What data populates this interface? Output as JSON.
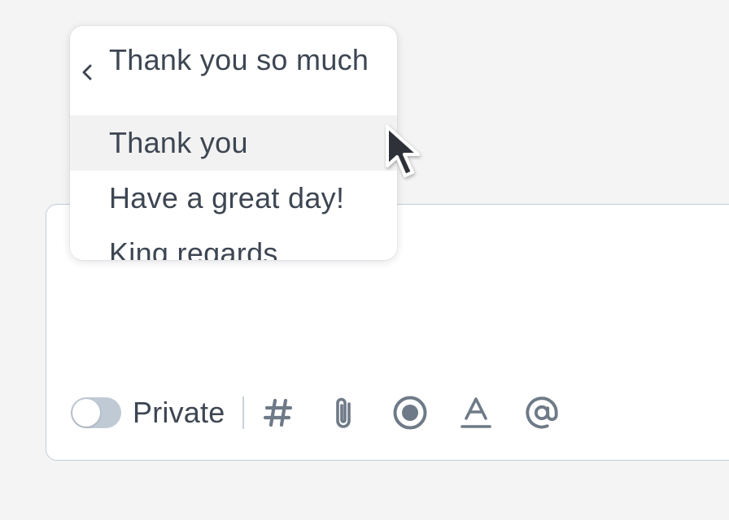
{
  "menu": {
    "header_label": "Thank you so much",
    "items": [
      {
        "label": "Thank you",
        "hovered": true
      },
      {
        "label": "Have a great day!",
        "hovered": false
      },
      {
        "label": "King regards",
        "hovered": false
      }
    ]
  },
  "composer": {
    "private_toggle": {
      "label": "Private",
      "on": false
    },
    "tools": [
      {
        "icon": "hashtag-icon"
      },
      {
        "icon": "paperclip-icon"
      },
      {
        "icon": "record-icon"
      },
      {
        "icon": "text-format-icon"
      },
      {
        "icon": "mention-icon"
      }
    ]
  },
  "colors": {
    "background": "#f4f4f4",
    "text": "#3d4652",
    "icon": "#6e7a87",
    "toggle_off": "#c0cad5",
    "border": "#c3ccd6",
    "hover": "#f2f2f2"
  }
}
